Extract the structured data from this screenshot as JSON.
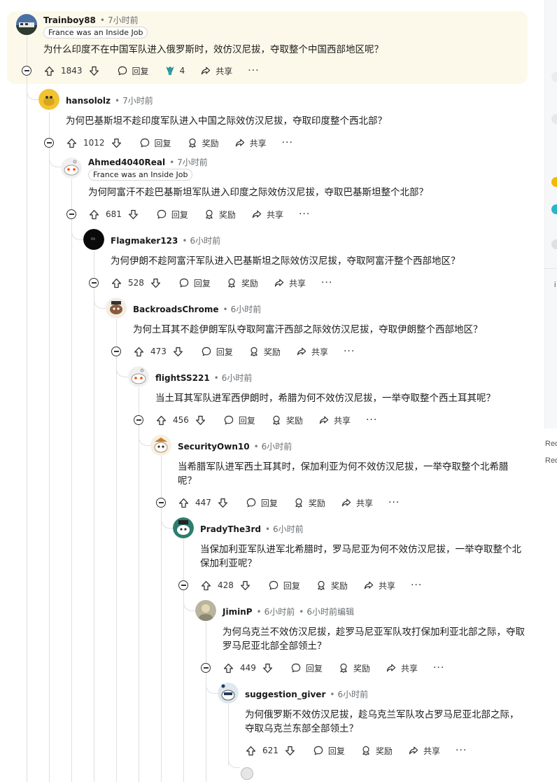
{
  "actions": {
    "reply": "回复",
    "award": "奖励",
    "share": "共享",
    "more": "···"
  },
  "op": {
    "user": "Trainboy88",
    "time": "7小时前",
    "flair": "France was an Inside Job",
    "text": "为什么印度不在中国军队进入俄罗斯时，效仿汉尼拔，夺取整个中国西部地区呢？",
    "votes": "1843",
    "award_count": "4"
  },
  "comments": [
    {
      "user": "hansololz",
      "time": "7小时前",
      "text": "为何巴基斯坦不趁印度军队进入中国之际效仿汉尼拔，夺取印度整个西北部？",
      "votes": "1012"
    },
    {
      "user": "Ahmed4040Real",
      "time": "7小时前",
      "flair": "France was an Inside Job",
      "text": "为何阿富汗不趁巴基斯坦军队进入印度之际效仿汉尼拔，夺取巴基斯坦整个北部？",
      "votes": "681"
    },
    {
      "user": "Flagmaker123",
      "time": "6小时前",
      "text": "为何伊朗不趁阿富汗军队进入巴基斯坦之际效仿汉尼拔，夺取阿富汗整个西部地区？",
      "votes": "528"
    },
    {
      "user": "BackroadsChrome",
      "time": "6小时前",
      "text": "为何土耳其不趁伊朗军队夺取阿富汗西部之际效仿汉尼拔，夺取伊朗整个西部地区？",
      "votes": "473"
    },
    {
      "user": "flightSS221",
      "time": "6小时前",
      "text": "当土耳其军队进军西伊朗时，希腊为何不效仿汉尼拔，一举夺取整个西土耳其呢？",
      "votes": "456"
    },
    {
      "user": "SecurityOwn10",
      "time": "6小时前",
      "text": "当希腊军队进军西土耳其时，保加利亚为何不效仿汉尼拔，一举夺取整个北希腊呢？",
      "votes": "447"
    },
    {
      "user": "PradyThe3rd",
      "time": "6小时前",
      "text": "当保加利亚军队进军北希腊时，罗马尼亚为何不效仿汉尼拔，一举夺取整个北保加利亚呢？",
      "votes": "428"
    },
    {
      "user": "JiminP",
      "time": "6小时前",
      "edited": "6小时前编辑",
      "text": "为何乌克兰不效仿汉尼拔，趁罗马尼亚军队攻打保加利亚北部之际，夺取罗马尼亚北部全部领土？",
      "votes": "449"
    },
    {
      "user": "suggestion_giver",
      "time": "6小时前",
      "text": "为何俄罗斯不效仿汉尼拔，趁乌克兰军队攻占罗马尼亚北部之际，夺取乌克兰东部全部领土？",
      "votes": "621"
    }
  ],
  "sidebar": {
    "label_1": "Red",
    "label_2": "Red",
    "label_3": "i"
  },
  "colors": {
    "op_background": "#fdf9ea",
    "thread_line": "#dcdfe3",
    "award_teal": "#29a3a8"
  }
}
